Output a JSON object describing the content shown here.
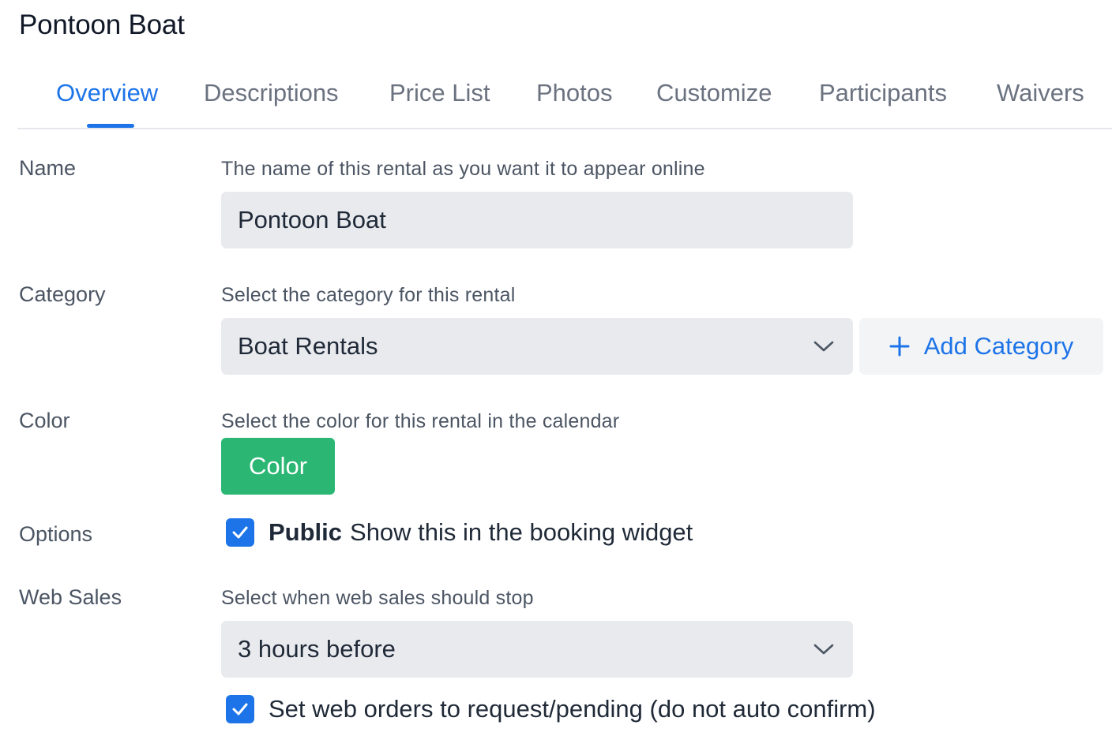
{
  "page": {
    "title": "Pontoon Boat"
  },
  "tabs": [
    {
      "label": "Overview",
      "active": true
    },
    {
      "label": "Descriptions",
      "active": false
    },
    {
      "label": "Price List",
      "active": false
    },
    {
      "label": "Photos",
      "active": false
    },
    {
      "label": "Customize",
      "active": false
    },
    {
      "label": "Participants",
      "active": false
    },
    {
      "label": "Waivers",
      "active": false
    }
  ],
  "form": {
    "name": {
      "label": "Name",
      "help": "The name of this rental as you want it to appear online",
      "value": "Pontoon Boat"
    },
    "category": {
      "label": "Category",
      "help": "Select the category for this rental",
      "value": "Boat Rentals",
      "add_button": "Add Category"
    },
    "color": {
      "label": "Color",
      "help": "Select the color for this rental in the calendar",
      "button": "Color",
      "swatch": "#2bb673"
    },
    "options": {
      "label": "Options",
      "public_bold": "Public",
      "public_text": "Show this in the booking widget",
      "public_checked": true
    },
    "web_sales": {
      "label": "Web Sales",
      "help": "Select when web sales should stop",
      "value": "3 hours before",
      "pending_text": "Set web orders to request/pending (do not auto confirm)",
      "pending_checked": true
    }
  },
  "colors": {
    "accent": "#1d74e8",
    "success": "#2bb673",
    "field_bg": "#e8eaee"
  }
}
